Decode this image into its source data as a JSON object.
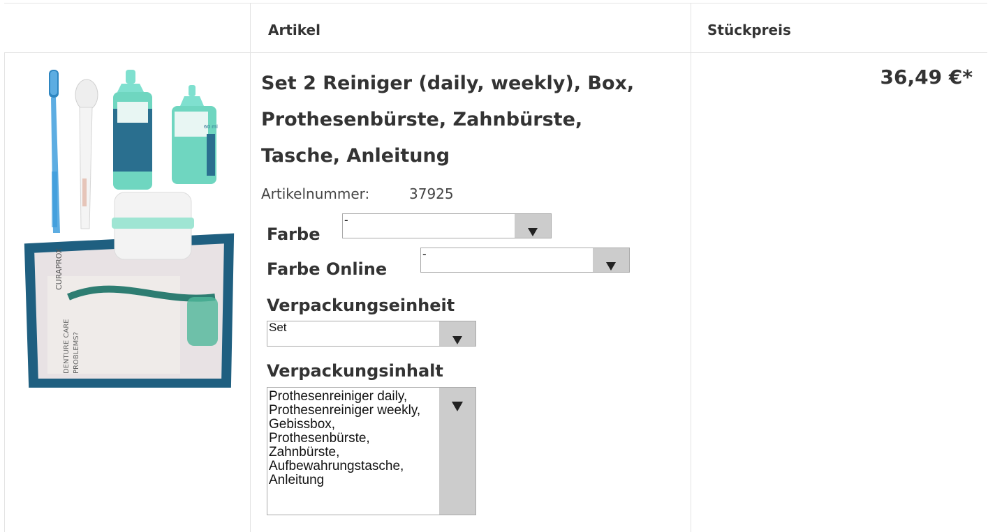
{
  "table": {
    "headers": {
      "article": "Artikel",
      "unit_price": "Stückpreis"
    }
  },
  "product": {
    "title_lines": [
      "Set 2 Reiniger (daily, weekly), Box,",
      "Prothesenbürste, Zahnbürste,",
      "Tasche, Anleitung"
    ],
    "article_number_label": "Artikelnummer:",
    "article_number": "37925",
    "price": "36,49 €*",
    "image_text": {
      "brand": "CURAPROX",
      "pouch_line1": "DENTURE CARE",
      "pouch_line2": "PROBLEMS?",
      "bottle_ml": "60 ml"
    },
    "options": {
      "farbe": {
        "label": "Farbe",
        "value": "-"
      },
      "farbe_online": {
        "label": "Farbe Online",
        "value": "-"
      },
      "verpackungseinheit": {
        "label": "Verpackungseinheit",
        "value": "Set"
      },
      "verpackungsinhalt": {
        "label": "Verpackungsinhalt",
        "lines": [
          "Prothesenreiniger daily,",
          "Prothesenreiniger weekly,",
          "Gebissbox,",
          "Prothesenbürste,",
          "Zahnbürste,",
          "Aufbewahrungstasche,",
          "Anleitung"
        ]
      }
    }
  },
  "colors": {
    "accent_teal": "#2a6f8f",
    "mint": "#6fd6c0",
    "border": "#e3e3e3"
  }
}
